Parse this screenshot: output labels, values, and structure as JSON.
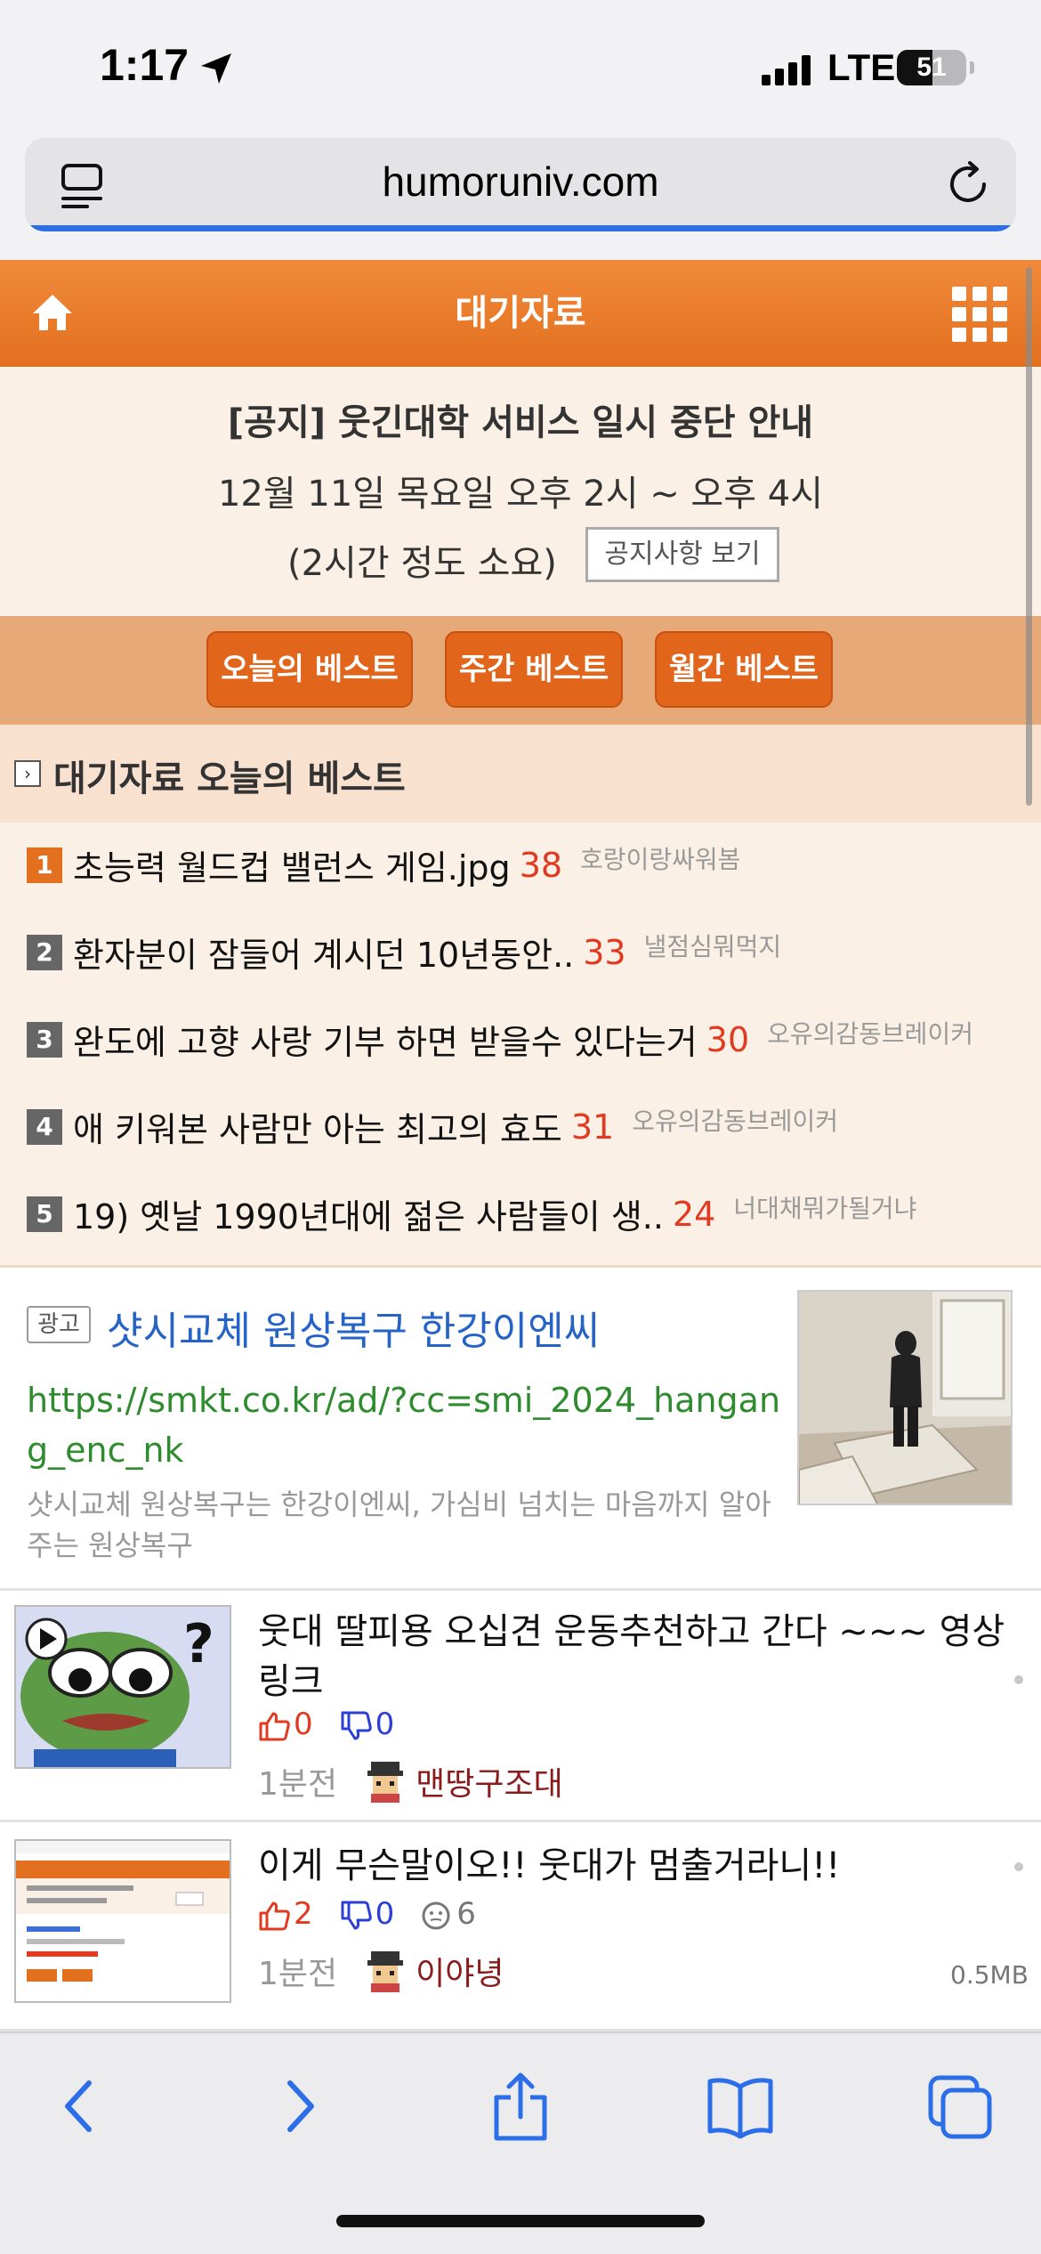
{
  "status_bar": {
    "time": "1:17",
    "network": "LTE",
    "battery_level": "51",
    "battery_fraction": 0.51
  },
  "browser": {
    "url": "humoruniv.com",
    "load_progress": 1.0
  },
  "header": {
    "title": "대기자료",
    "home_icon": "home-icon",
    "menu_icon": "grid-icon"
  },
  "notice": {
    "title": "[공지] 웃긴대학 서비스 일시 중단 안내",
    "line2": "12월 11일 목요일 오후 2시 ~ 오후 4시",
    "line3": "(2시간 정도 소요)",
    "button": "공지사항 보기"
  },
  "best_tabs": [
    "오늘의 베스트",
    "주간 베스트",
    "월간 베스트"
  ],
  "section": {
    "title": "대기자료 오늘의 베스트"
  },
  "best_list": [
    {
      "rank": "1",
      "title": "초능력 월드컵 밸런스 게임.jpg",
      "count": "38",
      "author": "호랑이랑싸워봄"
    },
    {
      "rank": "2",
      "title": "환자분이 잠들어 계시던 10년동안..",
      "count": "33",
      "author": "낼점심뭐먹지"
    },
    {
      "rank": "3",
      "title": "완도에 고향 사랑 기부 하면 받을수 있다는거",
      "count": "30",
      "author": "오유의감동브레이커"
    },
    {
      "rank": "4",
      "title": "애 키워본 사람만 아는 최고의 효도",
      "count": "31",
      "author": "오유의감동브레이커"
    },
    {
      "rank": "5",
      "title": "19) 옛날 1990년대에 젊은 사람들이 생..",
      "count": "24",
      "author": "너대채뭐가될거냐"
    }
  ],
  "ad": {
    "badge": "광고",
    "title": "샷시교체 원상복구 한강이엔씨",
    "url": "https://smkt.co.kr/ad/?cc=smi_2024_hangang_enc_nk",
    "description": "샷시교체 원상복구는 한강이엔씨, 가심비 넘치는 마음까지 알아주는 원상복구"
  },
  "posts": [
    {
      "title": "웃대 딸피용 오십견 운동추천하고 간다 ~~~ 영상 링크",
      "up": "0",
      "down": "0",
      "ago": "1분전",
      "author": "맨땅구조대"
    },
    {
      "title": "이게 무슨말이오!! 웃대가 멈출거라니!!",
      "up": "2",
      "down": "0",
      "views": "6",
      "ago": "1분전",
      "author": "이야녕",
      "size": "0.5MB"
    }
  ],
  "colors": {
    "accent": "#e2701f",
    "up": "#e03b20",
    "down": "#2b3fd6",
    "link": "#2563c6",
    "url_green": "#2e8b2e"
  }
}
